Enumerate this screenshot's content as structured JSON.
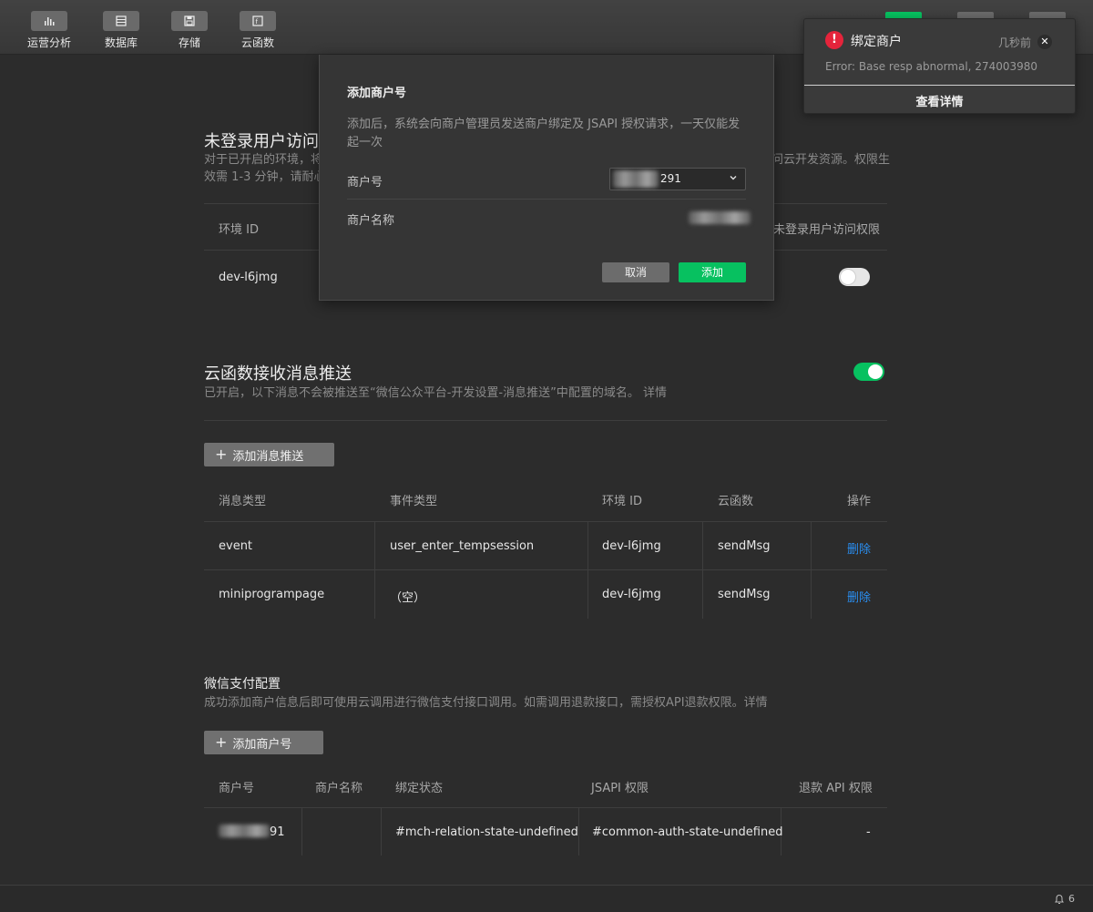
{
  "toolbar": {
    "items": [
      {
        "label": "运营分析",
        "icon": "bar-chart-icon"
      },
      {
        "label": "数据库",
        "icon": "database-icon"
      },
      {
        "label": "存储",
        "icon": "storage-icon"
      },
      {
        "label": "云函数",
        "icon": "function-icon"
      }
    ]
  },
  "unlogged": {
    "title": "未登录用户访问云",
    "desc_line1": "对于已开启的环境，将",
    "desc_line1_right": "问云开发资源。权限生",
    "desc_line2": "效需 1-3 分钟，请耐心",
    "headers": {
      "env": "环境 ID",
      "perm": "未登录用户访问权限"
    },
    "row": {
      "env": "dev-l6jmg"
    }
  },
  "msg_push": {
    "title": "云函数接收消息推送",
    "desc": "已开启，以下消息不会被推送至“微信公众平台-开发设置-消息推送”中配置的域名。 详情",
    "add_button": "添加消息推送",
    "headers": {
      "msg_type": "消息类型",
      "event_type": "事件类型",
      "env": "环境 ID",
      "func": "云函数",
      "ops": "操作"
    },
    "rows": [
      {
        "msg_type": "event",
        "event_type": "user_enter_tempsession",
        "env": "dev-l6jmg",
        "func": "sendMsg",
        "op": "删除"
      },
      {
        "msg_type": "miniprogrampage",
        "event_type": "（空）",
        "env": "dev-l6jmg",
        "func": "sendMsg",
        "op": "删除"
      }
    ]
  },
  "pay": {
    "title": "微信支付配置",
    "desc": "成功添加商户信息后即可使用云调用进行微信支付接口调用。如需调用退款接口，需授权API退款权限。详情",
    "add_button": "添加商户号",
    "headers": {
      "mch_id": "商户号",
      "mch_name": "商户名称",
      "bind": "绑定状态",
      "jsapi": "JSAPI 权限",
      "refund": "退款 API 权限"
    },
    "row": {
      "mch_id_suffix": "91",
      "bind": "#mch-relation-state-undefined",
      "jsapi": "#common-auth-state-undefined",
      "refund": "-"
    }
  },
  "modal": {
    "title": "添加商户号",
    "desc": "添加后，系统会向商户管理员发送商户绑定及 JSAPI 授权请求，一天仅能发起一次",
    "mch_label": "商户号",
    "mch_value_suffix": "291",
    "name_label": "商户名称",
    "cancel": "取消",
    "add": "添加"
  },
  "notification": {
    "title": "绑定商户",
    "time": "几秒前",
    "message": "Error: Base resp abnormal, 274003980",
    "action": "查看详情"
  },
  "statusbar": {
    "bell_count": "6"
  },
  "colors": {
    "accent": "#07c160",
    "link": "#2a8ef0",
    "error": "#e5243b"
  }
}
